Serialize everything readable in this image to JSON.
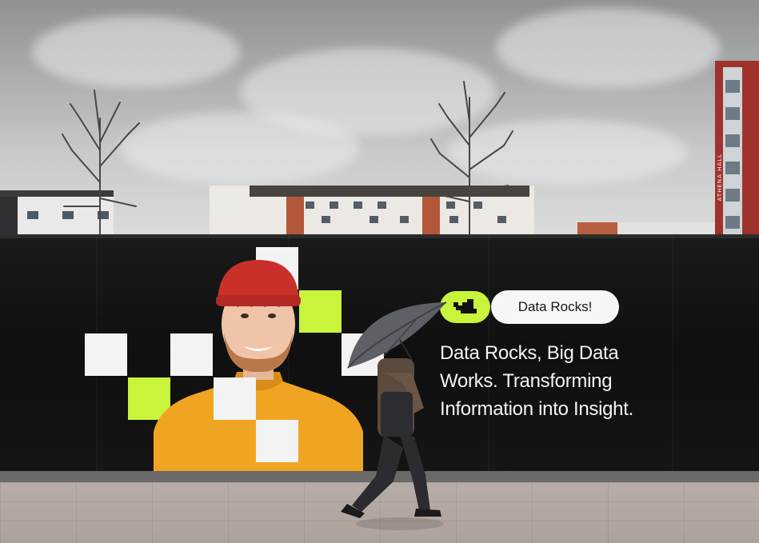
{
  "building": {
    "sign": "ATHENA HALL"
  },
  "billboard": {
    "tag": "Data Rocks!",
    "headline": [
      "Data Rocks, Big Data",
      "Works. Transforming",
      "Information into Insight."
    ],
    "logo": "data-rocks-logo",
    "colors": {
      "accent": "#c8f43b",
      "background": "#111111",
      "text": "#f4f4f4",
      "tile": "#f3f3f3"
    }
  }
}
